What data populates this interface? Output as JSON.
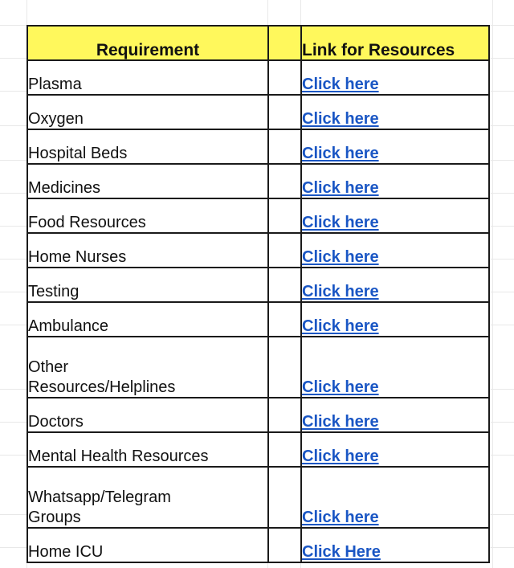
{
  "sheet": {
    "background_color": "#ffffff",
    "gridline_color": "#e8e8e8",
    "border_color": "#1a1a1a"
  },
  "table": {
    "header_background": "#fff85c",
    "spacer_background": "#f1f1f1",
    "link_color": "#1a56c4",
    "columns": [
      {
        "key": "requirement",
        "label": "Requirement",
        "align": "center"
      },
      {
        "key": "spacer",
        "label": "",
        "align": "center"
      },
      {
        "key": "link",
        "label": "Link for Resources",
        "align": "left"
      }
    ],
    "rows": [
      {
        "requirement": "Plasma",
        "link": "Click here",
        "tall": false
      },
      {
        "requirement": "Oxygen",
        "link": "Click here",
        "tall": false
      },
      {
        "requirement": "Hospital Beds",
        "link": "Click here",
        "tall": false
      },
      {
        "requirement": "Medicines",
        "link": "Click here",
        "tall": false
      },
      {
        "requirement": "Food Resources",
        "link": "Click here",
        "tall": false
      },
      {
        "requirement": "Home Nurses",
        "link": "Click here",
        "tall": false
      },
      {
        "requirement": "Testing",
        "link": "Click here",
        "tall": false
      },
      {
        "requirement": "Ambulance",
        "link": "Click here",
        "tall": false
      },
      {
        "requirement": "Other\nResources/Helplines",
        "link": "Click here",
        "tall": true
      },
      {
        "requirement": "Doctors",
        "link": "Click here",
        "tall": false
      },
      {
        "requirement": "Mental Health Resources",
        "link": "Click here",
        "tall": false
      },
      {
        "requirement": "Whatsapp/Telegram\nGroups",
        "link": "Click here",
        "tall": true
      },
      {
        "requirement": "Home ICU",
        "link": "Click Here",
        "tall": false
      }
    ]
  }
}
